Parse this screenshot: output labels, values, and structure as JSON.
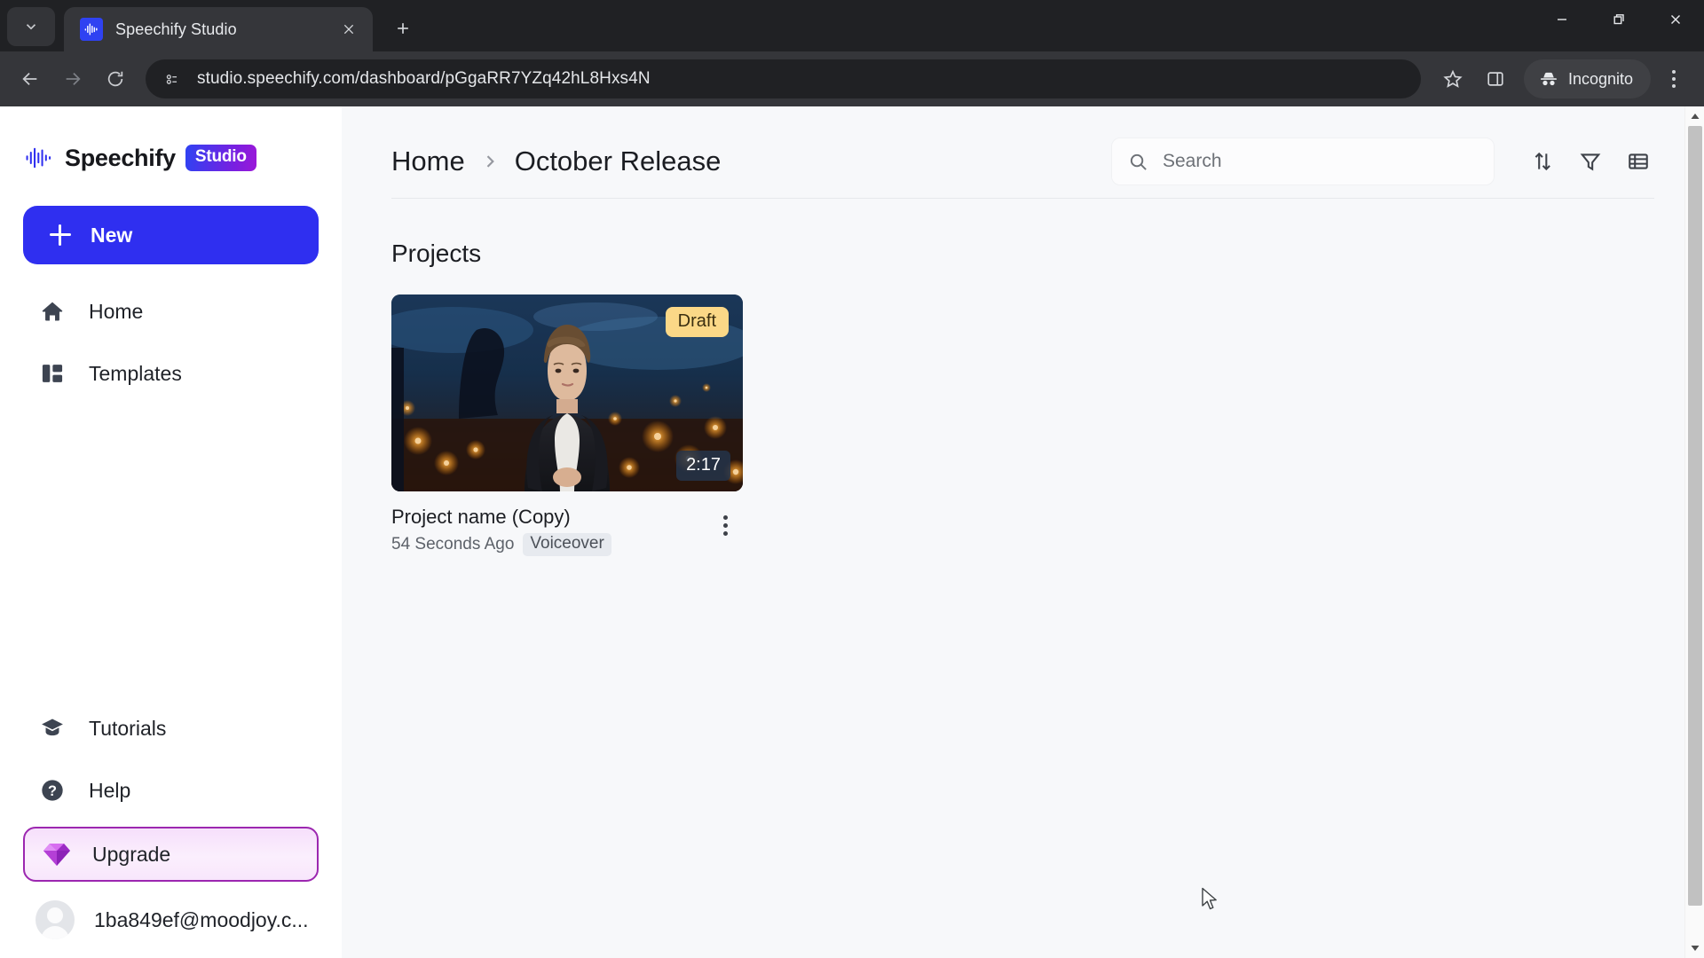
{
  "browser": {
    "tab": {
      "title": "Speechify Studio",
      "favicon_icon": "speechify-waveform-icon"
    },
    "tab_search_icon": "chevron-down-icon",
    "new_tab_icon": "plus-icon",
    "close_tab_icon": "close-icon",
    "nav": {
      "back_icon": "arrow-left-icon",
      "forward_icon": "arrow-right-icon",
      "reload_icon": "reload-icon"
    },
    "omnibox": {
      "site_info_icon": "page-info-icon",
      "url": "studio.speechify.com/dashboard/pGgaRR7YZq42hL8Hxs4N"
    },
    "actions": {
      "bookmark_icon": "star-icon",
      "side_panel_icon": "side-panel-icon",
      "incognito_label": "Incognito",
      "incognito_icon": "incognito-hat-icon",
      "menu_icon": "three-dots-vertical-icon"
    },
    "window_controls": {
      "minimize_icon": "minimize-icon",
      "maximize_icon": "restore-icon",
      "close_icon": "close-icon"
    }
  },
  "sidebar": {
    "brand": {
      "name": "Speechify",
      "badge": "Studio",
      "logo_icon": "speechify-waveform-icon"
    },
    "new_button": {
      "label": "New",
      "icon": "plus-icon"
    },
    "items": [
      {
        "label": "Home",
        "icon": "home-icon"
      },
      {
        "label": "Templates",
        "icon": "templates-icon"
      }
    ],
    "bottom_items": [
      {
        "label": "Tutorials",
        "icon": "graduation-cap-icon"
      },
      {
        "label": "Help",
        "icon": "question-circle-icon"
      }
    ],
    "upgrade": {
      "label": "Upgrade",
      "icon": "gem-icon",
      "border_color": "#9c27b0"
    },
    "account": {
      "email": "1ba849ef@moodjoy.c...",
      "avatar_icon": "user-avatar-icon"
    }
  },
  "main": {
    "breadcrumb": {
      "home": "Home",
      "separator_icon": "chevron-right-icon",
      "current": "October Release"
    },
    "search": {
      "placeholder": "Search",
      "value": "",
      "icon": "search-icon"
    },
    "tools": [
      {
        "name": "sort-button",
        "icon": "sort-arrows-icon"
      },
      {
        "name": "filter-button",
        "icon": "funnel-icon"
      },
      {
        "name": "view-toggle-button",
        "icon": "list-view-icon"
      }
    ],
    "section_title": "Projects",
    "projects": [
      {
        "title": "Project name (Copy)",
        "time": "54 Seconds Ago",
        "tag": "Voiceover",
        "status_badge": "Draft",
        "duration": "2:17",
        "menu_icon": "three-dots-vertical-icon",
        "thumbnail_alt": "woman-presenter-night-lanterns"
      }
    ]
  },
  "colors": {
    "accent_blue": "#2f2ff0",
    "draft_badge": "#fbd887",
    "upgrade_purple": "#9c27b0",
    "page_bg": "#f7f8fa"
  }
}
